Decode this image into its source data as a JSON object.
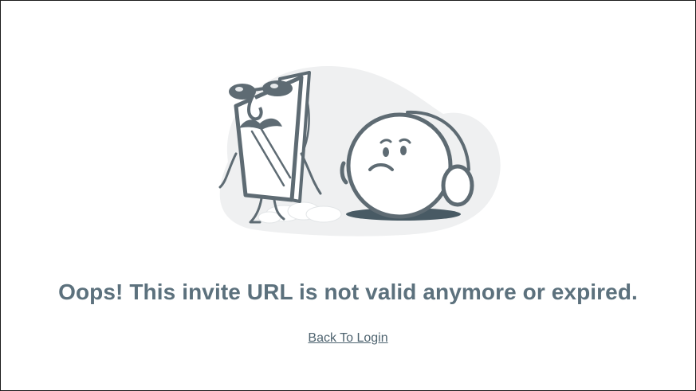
{
  "error": {
    "message": "Oops! This invite URL is not valid anymore or expired."
  },
  "actions": {
    "back_to_login": "Back To Login"
  },
  "colors": {
    "text": "#5c717d",
    "link": "#4f6470",
    "illustration_stroke": "#5e6b73",
    "illustration_bg": "#eff0f1"
  }
}
